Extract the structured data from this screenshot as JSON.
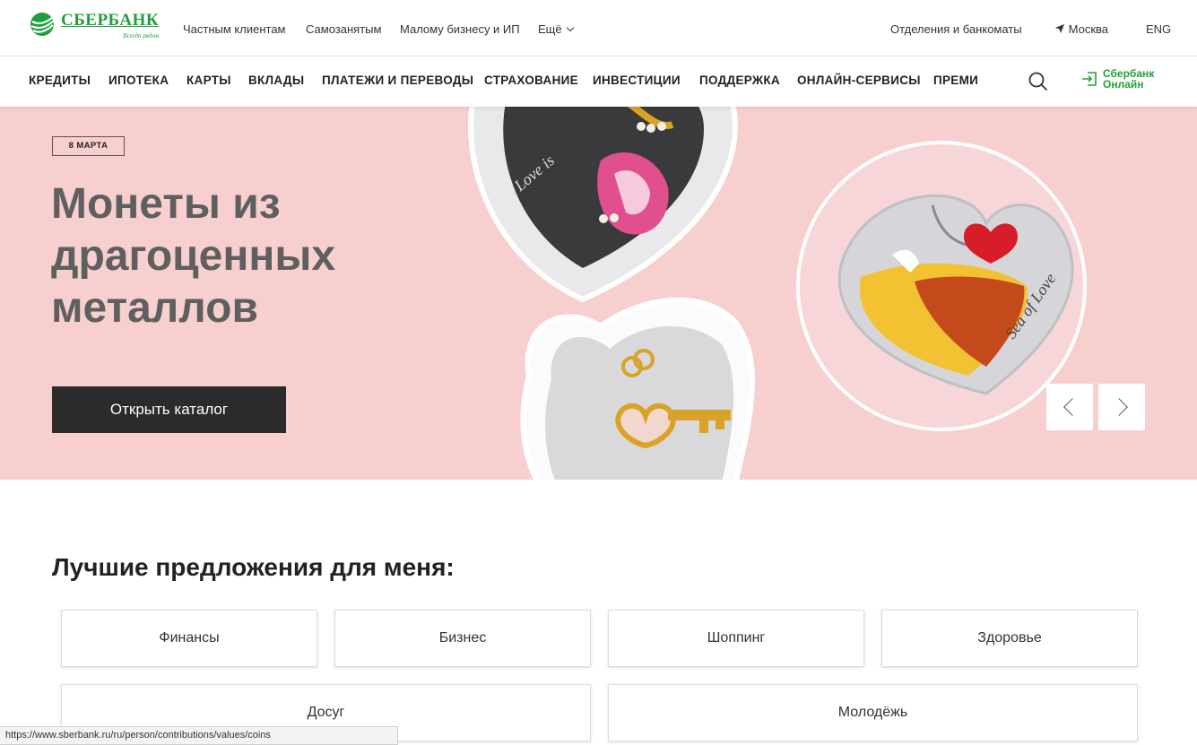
{
  "brand": {
    "name": "СБЕРБАНК",
    "slogan": "Всегда рядом",
    "green": "#21a038"
  },
  "topnav": {
    "items": [
      "Частным клиентам",
      "Самозанятым",
      "Малому бизнесу и ИП",
      "Ещё"
    ],
    "right": {
      "branches": "Отделения и банкоматы",
      "city": "Москва",
      "lang": "ENG"
    }
  },
  "mainnav": {
    "items": [
      "КРЕДИТЫ",
      "ИПОТЕКА",
      "КАРТЫ",
      "ВКЛАДЫ",
      "ПЛАТЕЖИ И ПЕРЕВОДЫ",
      "СТРАХОВАНИЕ",
      "ИНВЕСТИЦИИ",
      "ПОДДЕРЖКА",
      "ОНЛАЙН-СЕРВИСЫ",
      "ПРЕМИ"
    ],
    "online_line1": "Сбербанк",
    "online_line2": "Онлайн"
  },
  "hero": {
    "tag": "8 МАРТА",
    "title": "Монеты из драгоценных металлов",
    "button": "Открыть каталог",
    "background": "#f8cfcf"
  },
  "offers": {
    "title": "Лучшие предложения для меня:",
    "tiles": [
      "Финансы",
      "Бизнес",
      "Шоппинг",
      "Здоровье",
      "Досуг",
      "Молодёжь"
    ]
  },
  "status_url": "https://www.sberbank.ru/ru/person/contributions/values/coins"
}
